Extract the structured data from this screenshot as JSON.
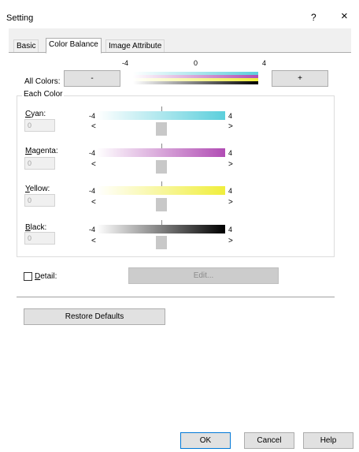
{
  "window": {
    "title": "Setting",
    "help_glyph": "?",
    "close_glyph": "×"
  },
  "tabs": [
    {
      "label": "Basic"
    },
    {
      "label": "Color Balance"
    },
    {
      "label": "Image Attribute"
    }
  ],
  "all_colors": {
    "label": "All Colors:",
    "minus_label": "-",
    "plus_label": "+",
    "tick_min": "-4",
    "tick_mid": "0",
    "tick_max": "4"
  },
  "each_color": {
    "title": "Each Color",
    "tick_min": "-4",
    "tick_max": "4",
    "left_arrow": "<",
    "right_arrow": ">",
    "channels": [
      {
        "label": "Cyan:",
        "key": "C",
        "rest": "yan:",
        "value": "0",
        "color": "#5ccfdc",
        "level": 0
      },
      {
        "label": "Magenta:",
        "key": "M",
        "rest": "agenta:",
        "value": "0",
        "color": "#b14db4",
        "level": 0
      },
      {
        "label": "Yellow:",
        "key": "Y",
        "rest": "ellow:",
        "value": "0",
        "color": "#f0ee3c",
        "level": 0
      },
      {
        "label": "Black:",
        "key": "B",
        "rest": "lack:",
        "value": "0",
        "color": "#000000",
        "level": 0
      }
    ]
  },
  "detail": {
    "key": "D",
    "rest": "etail:",
    "checked": false,
    "edit_label": "Edit..."
  },
  "restore": {
    "label": "Restore Defaults"
  },
  "footer": {
    "ok": "OK",
    "cancel": "Cancel",
    "help": "Help"
  },
  "colors": {
    "cyan": "#5ccfdc",
    "magenta": "#b14db4",
    "yellow": "#f0ee3c",
    "black": "#000000",
    "disabled_button": "#cccccc"
  }
}
